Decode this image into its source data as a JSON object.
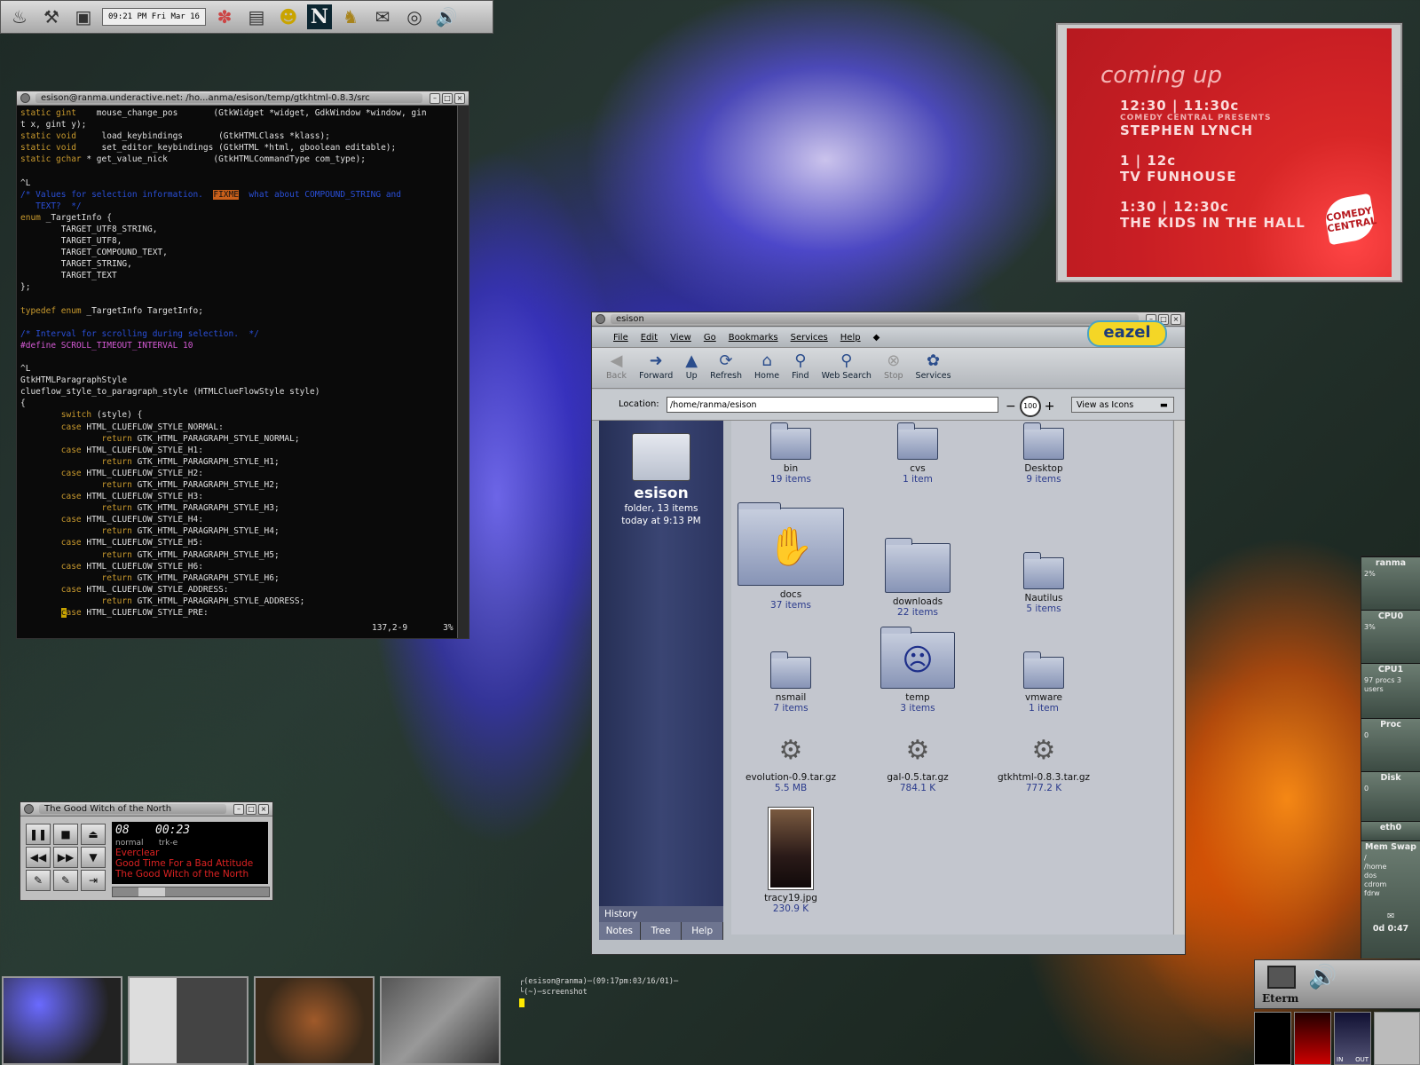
{
  "panel": {
    "clock": "09:21 PM Fri Mar 16",
    "icons": [
      "gnome-foot-icon",
      "tool-icon",
      "monitor-icon",
      "clock-applet",
      "fish-icon",
      "terminal-icon",
      "user-icon",
      "netscape-icon",
      "dog-icon",
      "mail-icon",
      "cd-icon",
      "speaker-icon"
    ],
    "netscape_label": "N"
  },
  "terminal": {
    "title": "esison@ranma.underactive.net: /ho...anma/esison/temp/gtkhtml-0.8.3/src",
    "status_pos": "137,2-9",
    "status_pct": "3%"
  },
  "tv": {
    "heading": "coming up",
    "items": [
      {
        "time": "12:30 | 11:30c",
        "sub": "COMEDY CENTRAL PRESENTS",
        "show": "STEPHEN LYNCH"
      },
      {
        "time": "1 | 12c",
        "sub": "",
        "show": "TV FUNHOUSE"
      },
      {
        "time": "1:30 | 12:30c",
        "sub": "",
        "show": "THE KIDS IN THE HALL"
      }
    ],
    "logo": "COMEDY CENTRAL"
  },
  "nautilus": {
    "title": "esison",
    "menu": [
      "File",
      "Edit",
      "View",
      "Go",
      "Bookmarks",
      "Services",
      "Help"
    ],
    "toolbar": [
      {
        "label": "Back",
        "icon": "back-arrow-icon",
        "glyph": "◀",
        "disabled": true
      },
      {
        "label": "Forward",
        "icon": "forward-arrow-icon",
        "glyph": "➜",
        "disabled": false
      },
      {
        "label": "Up",
        "icon": "up-arrow-icon",
        "glyph": "▲",
        "disabled": false
      },
      {
        "label": "Refresh",
        "icon": "refresh-icon",
        "glyph": "⟳",
        "disabled": false
      },
      {
        "label": "Home",
        "icon": "home-icon",
        "glyph": "⌂",
        "disabled": false
      },
      {
        "label": "Find",
        "icon": "find-icon",
        "glyph": "⚲",
        "disabled": false
      },
      {
        "label": "Web Search",
        "icon": "web-search-icon",
        "glyph": "⚲",
        "disabled": false
      },
      {
        "label": "Stop",
        "icon": "stop-icon",
        "glyph": "⊗",
        "disabled": true
      },
      {
        "label": "Services",
        "icon": "services-icon",
        "glyph": "✿",
        "disabled": false
      }
    ],
    "logo": "eazel",
    "location_label": "Location:",
    "location_value": "/home/ranma/esison",
    "zoom_level": "100",
    "view_mode": "View as Icons",
    "sidebar": {
      "name": "esison",
      "info1": "folder, 13 items",
      "info2": "today at 9:13 PM",
      "history_tab": "History",
      "tabs": [
        "Notes",
        "Tree",
        "Help"
      ]
    },
    "items": [
      {
        "name": "bin",
        "count": "19 items",
        "kind": "folder"
      },
      {
        "name": "cvs",
        "count": "1 item",
        "kind": "folder"
      },
      {
        "name": "Desktop",
        "count": "9 items",
        "kind": "folder"
      },
      {
        "name": "docs",
        "count": "37 items",
        "kind": "folder-large"
      },
      {
        "name": "downloads",
        "count": "22 items",
        "kind": "folder"
      },
      {
        "name": "Nautilus",
        "count": "5 items",
        "kind": "folder"
      },
      {
        "name": "nsmail",
        "count": "7 items",
        "kind": "folder"
      },
      {
        "name": "temp",
        "count": "3 items",
        "kind": "folder-emblem"
      },
      {
        "name": "vmware",
        "count": "1 item",
        "kind": "folder"
      },
      {
        "name": "evolution-0.9.tar.gz",
        "count": "5.5 MB",
        "kind": "package"
      },
      {
        "name": "gal-0.5.tar.gz",
        "count": "784.1 K",
        "kind": "package"
      },
      {
        "name": "gtkhtml-0.8.3.tar.gz",
        "count": "777.2 K",
        "kind": "package"
      },
      {
        "name": "tracy19.jpg",
        "count": "230.9 K",
        "kind": "image"
      }
    ]
  },
  "xmms": {
    "title": "The Good Witch of the North",
    "track_no": "08",
    "time": "00:23",
    "mode": "normal",
    "mode2": "trk-e",
    "artist": "Everclear",
    "album": "Good Time For a Bad Attitude",
    "song": "The Good Witch of the North",
    "seek_fraction": 0.2
  },
  "shell": {
    "prompt": "┌(esison@ranma)─(09:17pm:03/16/01)─",
    "command": "└(~)─screenshot"
  },
  "gkrellm": {
    "host": "ranma",
    "sections": [
      {
        "label": "ranma",
        "value": "2%"
      },
      {
        "label": "CPU0",
        "value": "3%"
      },
      {
        "label": "CPU1",
        "value": "97 procs 3 users"
      },
      {
        "label": "Proc",
        "value": "0"
      },
      {
        "label": "Disk",
        "value": "0"
      },
      {
        "label": "eth0",
        "value": ""
      },
      {
        "label": "Mem Swap",
        "value": ""
      }
    ],
    "mounts": [
      "/",
      "/home",
      "dos",
      "cdrom",
      "fdrw"
    ],
    "uptime": "0d 0:47"
  },
  "eterm": {
    "label": "Eterm"
  },
  "mixer": {
    "in_label": "IN",
    "out_label": "OUT"
  }
}
